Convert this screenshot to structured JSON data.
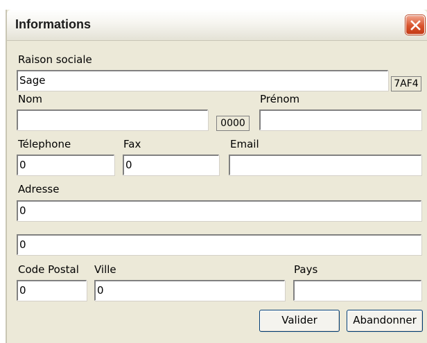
{
  "window": {
    "title": "Informations"
  },
  "form": {
    "raison_sociale": {
      "label": "Raison sociale",
      "value": "Sage",
      "code": "7AF4"
    },
    "nom": {
      "label": "Nom",
      "value": "",
      "code": "0000"
    },
    "prenom": {
      "label": "Prénom",
      "value": ""
    },
    "telephone": {
      "label": "Télephone",
      "value": "0"
    },
    "fax": {
      "label": "Fax",
      "value": "0"
    },
    "email": {
      "label": "Email",
      "value": ""
    },
    "adresse": {
      "label": "Adresse",
      "line1": "0",
      "line2": "0"
    },
    "code_postal": {
      "label": "Code Postal",
      "value": "0"
    },
    "ville": {
      "label": "Ville",
      "value": "0"
    },
    "pays": {
      "label": "Pays",
      "value": ""
    }
  },
  "buttons": {
    "valider": "Valider",
    "abandonner": "Abandonner"
  },
  "colors": {
    "dialog_bg": "#ece9d8",
    "close_button": "#d9542d"
  }
}
